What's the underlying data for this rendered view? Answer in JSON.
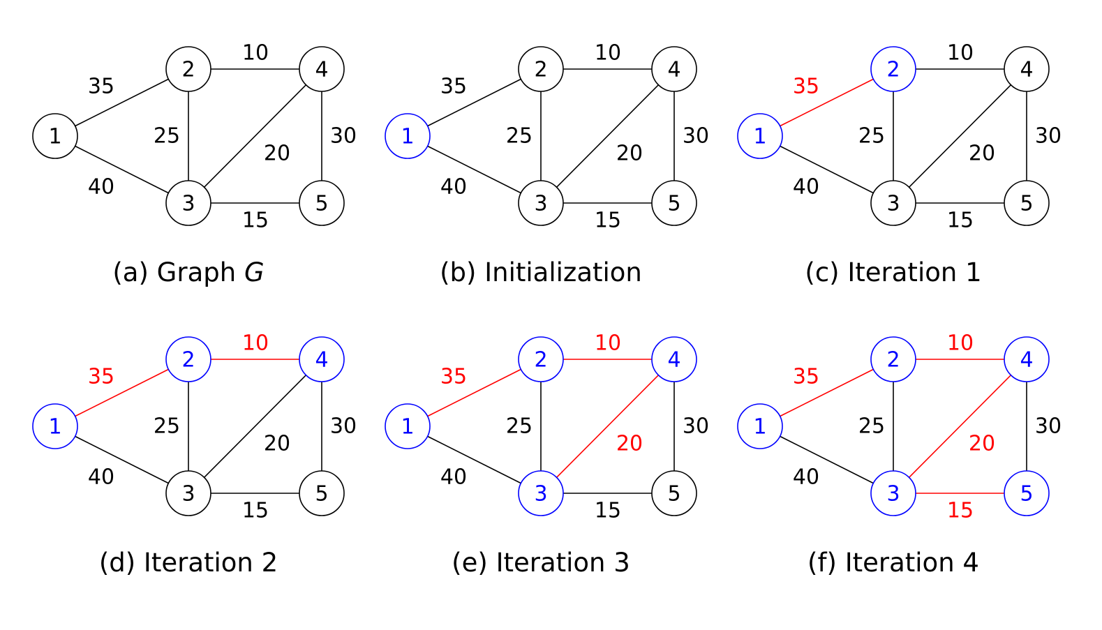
{
  "figure": {
    "colors": {
      "default": "#000000",
      "visited_node": "#0000ff",
      "tree_edge": "#ff0000"
    },
    "nodes": [
      "1",
      "2",
      "3",
      "4",
      "5"
    ],
    "edges": [
      {
        "id": "1-2",
        "from": "1",
        "to": "2",
        "weight": "35"
      },
      {
        "id": "1-3",
        "from": "1",
        "to": "3",
        "weight": "40"
      },
      {
        "id": "2-3",
        "from": "2",
        "to": "3",
        "weight": "25"
      },
      {
        "id": "2-4",
        "from": "2",
        "to": "4",
        "weight": "10"
      },
      {
        "id": "3-4",
        "from": "3",
        "to": "4",
        "weight": "20"
      },
      {
        "id": "4-5",
        "from": "4",
        "to": "5",
        "weight": "30"
      },
      {
        "id": "3-5",
        "from": "3",
        "to": "5",
        "weight": "15"
      }
    ],
    "panels": [
      {
        "id": "a",
        "caption_prefix": "(a) Graph ",
        "caption_italic": "G",
        "visited": [],
        "tree_edges": []
      },
      {
        "id": "b",
        "caption_prefix": "(b) Initialization",
        "caption_italic": "",
        "visited": [
          "1"
        ],
        "tree_edges": []
      },
      {
        "id": "c",
        "caption_prefix": "(c) Iteration 1",
        "caption_italic": "",
        "visited": [
          "1",
          "2"
        ],
        "tree_edges": [
          "1-2"
        ]
      },
      {
        "id": "d",
        "caption_prefix": "(d) Iteration 2",
        "caption_italic": "",
        "visited": [
          "1",
          "2",
          "4"
        ],
        "tree_edges": [
          "1-2",
          "2-4"
        ]
      },
      {
        "id": "e",
        "caption_prefix": "(e) Iteration 3",
        "caption_italic": "",
        "visited": [
          "1",
          "2",
          "3",
          "4"
        ],
        "tree_edges": [
          "1-2",
          "2-4",
          "3-4"
        ]
      },
      {
        "id": "f",
        "caption_prefix": "(f) Iteration 4",
        "caption_italic": "",
        "visited": [
          "1",
          "2",
          "3",
          "4",
          "5"
        ],
        "tree_edges": [
          "1-2",
          "2-4",
          "3-4",
          "3-5"
        ]
      }
    ]
  }
}
